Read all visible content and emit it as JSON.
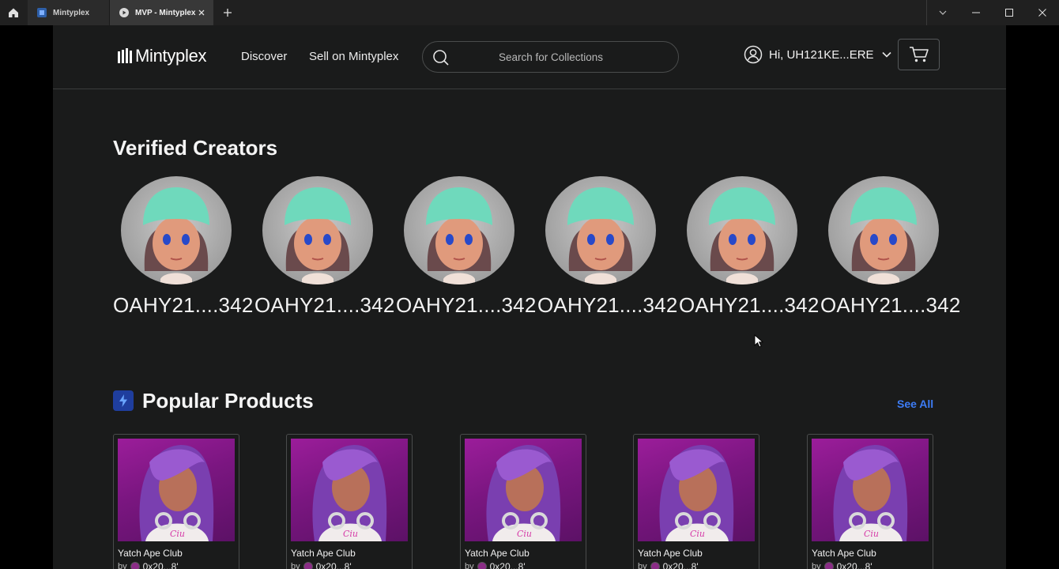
{
  "browser": {
    "tabs": [
      {
        "label": "Mintyplex",
        "active": false
      },
      {
        "label": "MVP - Mintyplex",
        "active": true
      }
    ]
  },
  "header": {
    "logo": "Mintyplex",
    "nav": [
      "Discover",
      "Sell on Mintyplex"
    ],
    "search_placeholder": "Search for Collections",
    "user_greeting": "Hi, UH121KE...ERE"
  },
  "verified_creators": {
    "title": "Verified Creators",
    "creators": [
      {
        "name": "OAHY21....342"
      },
      {
        "name": "OAHY21....342"
      },
      {
        "name": "OAHY21....342"
      },
      {
        "name": "OAHY21....342"
      },
      {
        "name": "OAHY21....342"
      },
      {
        "name": "OAHY21....342"
      }
    ]
  },
  "popular_products": {
    "title": "Popular Products",
    "see_all": "See All",
    "products": [
      {
        "title": "Yatch Ape Club",
        "by": "by",
        "creator": "0x20...8'"
      },
      {
        "title": "Yatch Ape Club",
        "by": "by",
        "creator": "0x20...8'"
      },
      {
        "title": "Yatch Ape Club",
        "by": "by",
        "creator": "0x20...8'"
      },
      {
        "title": "Yatch Ape Club",
        "by": "by",
        "creator": "0x20...8'"
      },
      {
        "title": "Yatch Ape Club",
        "by": "by",
        "creator": "0x20...8'"
      }
    ]
  },
  "colors": {
    "page_bg": "#1a1b1b",
    "accent": "#3d7cf5",
    "badge": "#1f3e9e",
    "beanie": "#6fd9bc",
    "product_bg": "#8a1a8c"
  }
}
